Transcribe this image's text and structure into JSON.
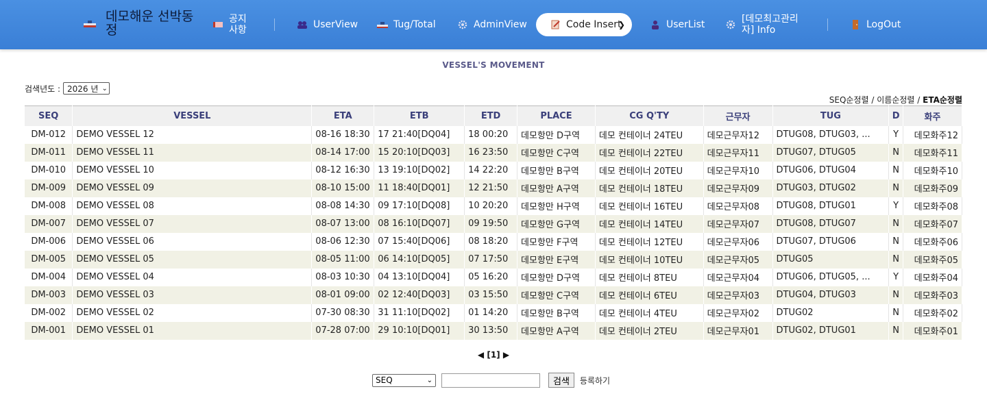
{
  "header": {
    "brand": "데모해운 선박동정",
    "nav": [
      {
        "id": "notice",
        "label": "공지\n사항",
        "icon": "notice-flag-icon"
      },
      {
        "id": "userview",
        "label": "UserView",
        "icon": "users-icon"
      },
      {
        "id": "tugtotal",
        "label": "Tug/Total",
        "icon": "ship-icon"
      },
      {
        "id": "adminview",
        "label": "AdminView",
        "icon": "gear-icon"
      },
      {
        "id": "userlist",
        "label": "UserList",
        "icon": "user-icon"
      },
      {
        "id": "admininfo",
        "label": "[데모최고관리자] Info",
        "icon": "gear-icon"
      },
      {
        "id": "logout",
        "label": "LogOut",
        "icon": "door-icon"
      }
    ],
    "code_insert": {
      "label": "Code Insert",
      "icon": "edit-icon"
    }
  },
  "page": {
    "title": "VESSEL'S MOVEMENT",
    "year_filter": {
      "label": "검색년도 :",
      "value": "2026 년"
    },
    "sort": {
      "seq": "SEQ순정렬",
      "name": "이름순정렬",
      "eta": "ETA순정렬",
      "sep": "/"
    }
  },
  "table": {
    "columns": [
      "SEQ",
      "VESSEL",
      "ETA",
      "ETB",
      "ETD",
      "PLACE",
      "CG Q'TY",
      "근무자",
      "TUG",
      "D",
      "화주"
    ],
    "rows": [
      [
        "DM-012",
        "DEMO VESSEL 12",
        "08-16 18:30",
        "17 21:40[DQ04]",
        "18 00:20",
        "데모항만 D구역",
        "데모 컨테이너 24TEU",
        "데모근무자12",
        "DTUG08, DTUG03, ...",
        "Y",
        "데모화주12"
      ],
      [
        "DM-011",
        "DEMO VESSEL 11",
        "08-14 17:00",
        "15 20:10[DQ03]",
        "16 23:50",
        "데모항만 C구역",
        "데모 컨테이너 22TEU",
        "데모근무자11",
        "DTUG07, DTUG05",
        "N",
        "데모화주11"
      ],
      [
        "DM-010",
        "DEMO VESSEL 10",
        "08-12 16:30",
        "13 19:10[DQ02]",
        "14 22:20",
        "데모항만 B구역",
        "데모 컨테이너 20TEU",
        "데모근무자10",
        "DTUG06, DTUG04",
        "N",
        "데모화주10"
      ],
      [
        "DM-009",
        "DEMO VESSEL 09",
        "08-10 15:00",
        "11 18:40[DQ01]",
        "12 21:50",
        "데모항만 A구역",
        "데모 컨테이너 18TEU",
        "데모근무자09",
        "DTUG03, DTUG02",
        "N",
        "데모화주09"
      ],
      [
        "DM-008",
        "DEMO VESSEL 08",
        "08-08 14:30",
        "09 17:10[DQ08]",
        "10 20:20",
        "데모항만 H구역",
        "데모 컨테이너 16TEU",
        "데모근무자08",
        "DTUG08, DTUG01",
        "Y",
        "데모화주08"
      ],
      [
        "DM-007",
        "DEMO VESSEL 07",
        "08-07 13:00",
        "08 16:10[DQ07]",
        "09 19:50",
        "데모항만 G구역",
        "데모 컨테이너 14TEU",
        "데모근무자07",
        "DTUG08, DTUG07",
        "N",
        "데모화주07"
      ],
      [
        "DM-006",
        "DEMO VESSEL 06",
        "08-06 12:30",
        "07 15:40[DQ06]",
        "08 18:20",
        "데모항만 F구역",
        "데모 컨테이너 12TEU",
        "데모근무자06",
        "DTUG07, DTUG06",
        "N",
        "데모화주06"
      ],
      [
        "DM-005",
        "DEMO VESSEL 05",
        "08-05 11:00",
        "06 14:10[DQ05]",
        "07 17:50",
        "데모항만 E구역",
        "데모 컨테이너 10TEU",
        "데모근무자05",
        "DTUG05",
        "N",
        "데모화주05"
      ],
      [
        "DM-004",
        "DEMO VESSEL 04",
        "08-03 10:30",
        "04 13:10[DQ04]",
        "05 16:20",
        "데모항만 D구역",
        "데모 컨테이너 8TEU",
        "데모근무자04",
        "DTUG06, DTUG05, ...",
        "Y",
        "데모화주04"
      ],
      [
        "DM-003",
        "DEMO VESSEL 03",
        "08-01 09:00",
        "02 12:40[DQ03]",
        "03 15:50",
        "데모항만 C구역",
        "데모 컨테이너 6TEU",
        "데모근무자03",
        "DTUG04, DTUG03",
        "N",
        "데모화주03"
      ],
      [
        "DM-002",
        "DEMO VESSEL 02",
        "07-30 08:30",
        "31 11:10[DQ02]",
        "01 14:20",
        "데모항만 B구역",
        "데모 컨테이너 4TEU",
        "데모근무자02",
        "DTUG02",
        "N",
        "데모화주02"
      ],
      [
        "DM-001",
        "DEMO VESSEL 01",
        "07-28 07:00",
        "29 10:10[DQ01]",
        "30 13:50",
        "데모항만 A구역",
        "데모 컨테이너 2TEU",
        "데모근무자01",
        "DTUG02, DTUG01",
        "N",
        "데모화주01"
      ]
    ]
  },
  "pager": {
    "prev": "◀",
    "current": "[1]",
    "next": "▶"
  },
  "search": {
    "field": "SEQ",
    "query": "",
    "button": "검색",
    "register": "등록하기"
  },
  "colors": {
    "header_bg": "#3a7fd6",
    "row_alt": "#f1f1e5",
    "th_text": "#3a3f7a"
  }
}
